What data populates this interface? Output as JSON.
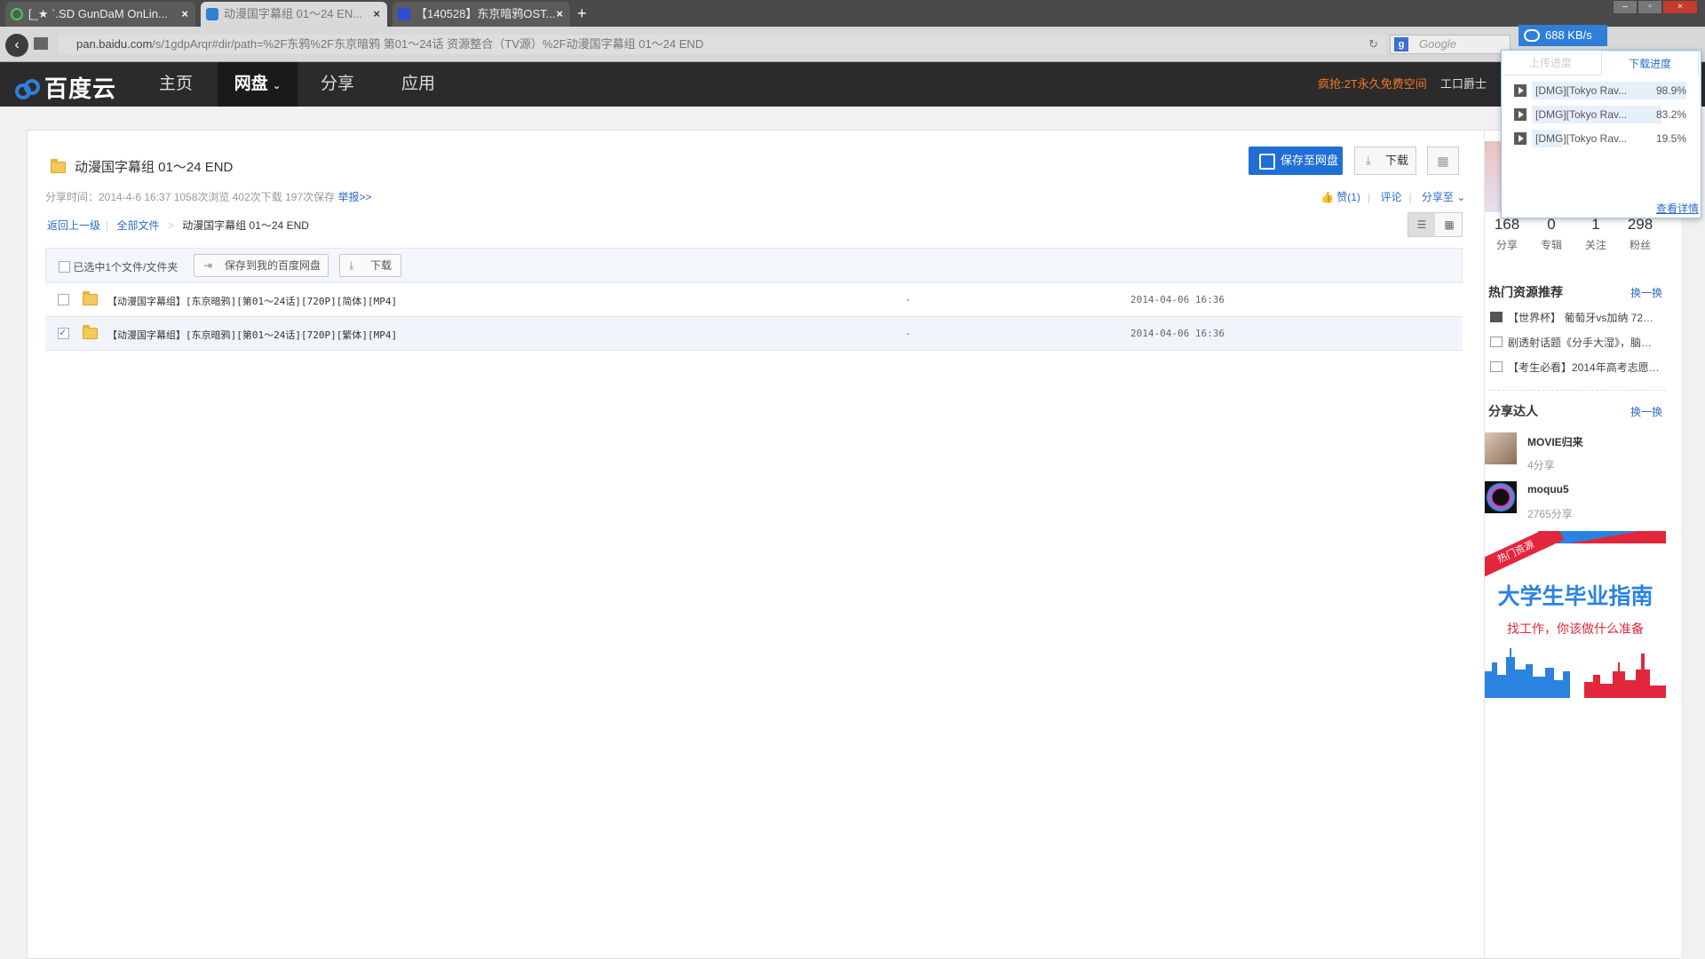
{
  "browser": {
    "tabs": [
      {
        "label": "[_★ `.SD GunDaM OnLin..."
      },
      {
        "label": "动漫国字幕组 01～24 EN..."
      },
      {
        "label": "【140528】东京暗鸦OST..."
      }
    ],
    "new_tab": "+",
    "url_host": "pan.baidu.com",
    "url_path": "/s/1gdpArqr#dir/path=%2F东鸦%2F东京暗鸦 第01～24话 资源整合（TV源）%2F动漫国字幕组 01～24 END",
    "search_placeholder": "Google",
    "download_speed": "688 KB/s"
  },
  "nav": {
    "logo": "百度云",
    "items": [
      "主页",
      "网盘",
      "分享",
      "应用"
    ],
    "promo": "疯抢:2T永久免费空间",
    "user": "工口爵士"
  },
  "share": {
    "title": "动漫国字幕组 01～24 END",
    "meta": "分享时间：2014-4-6 16:37 1058次浏览 402次下载 197次保存",
    "report": "举报>>",
    "save_button": "保存至网盘",
    "download_button": "下载",
    "qr_button": "▦",
    "like": "赞(1)",
    "comment": "评论",
    "share_to": "分享至",
    "breadcrumb_back": "返回上一级",
    "breadcrumb_all": "全部文件",
    "breadcrumb_sep": ">",
    "breadcrumb_current": "动漫国字幕组 01～24 END"
  },
  "toolbar": {
    "selected_text": "已选中1个文件/文件夹",
    "save_to_mine": "保存到我的百度网盘",
    "download": "下载"
  },
  "files": [
    {
      "name": "【动漫国字幕组】[东京暗鸦][第01～24话][720P][简体][MP4]",
      "size": "-",
      "date": "2014-04-06 16:36",
      "checked": false
    },
    {
      "name": "【动漫国字幕组】[东京暗鸦][第01～24话][720P][繁体][MP4]",
      "size": "-",
      "date": "2014-04-06 16:36",
      "checked": true
    }
  ],
  "sidebar": {
    "stats": [
      {
        "n": "168",
        "l": "分享"
      },
      {
        "n": "0",
        "l": "专辑"
      },
      {
        "n": "1",
        "l": "关注"
      },
      {
        "n": "298",
        "l": "粉丝"
      }
    ],
    "hot_title": "热门资源推荐",
    "hot_more": "换一换",
    "hot_items": [
      "【世界杯】 葡萄牙vs加纳 72…",
      "剧透射话题《分手大湿》，脑…",
      "【考生必看】2014年高考志愿…"
    ],
    "talent_title": "分享达人",
    "talent_more": "换一换",
    "talents": [
      {
        "name": "MOVIE归来",
        "count": "4分享"
      },
      {
        "name": "moquu5",
        "count": "2765分享"
      }
    ],
    "ad_tag": "热门资源",
    "ad_title": "大学生毕业指南",
    "ad_sub": "找工作，你该做什么准备"
  },
  "download_popup": {
    "tab_upload": "上传进度",
    "tab_download": "下载进度",
    "items": [
      {
        "name": "[DMG][Tokyo Rav...",
        "percent": "98.9%",
        "progress": 0.989
      },
      {
        "name": "[DMG][Tokyo Rav...",
        "percent": "83.2%",
        "progress": 0.832
      },
      {
        "name": "[DMG][Tokyo Rav...",
        "percent": "19.5%",
        "progress": 0.195
      }
    ],
    "more": "查看详情"
  },
  "colors": {
    "accent": "#1f6fd6",
    "promo": "#f47920",
    "nav_bg": "#2b2b2b",
    "link": "#2b6cc4"
  }
}
